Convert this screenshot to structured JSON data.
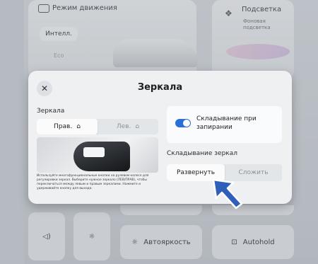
{
  "background": {
    "drive_mode": {
      "label": "Режим движения",
      "mode_button": "Интелл.",
      "mode_sub": "Eco"
    },
    "lighting": {
      "label": "Подсветка",
      "sub1": "Фоновая",
      "sub2": "подсветка"
    },
    "bottom": {
      "auto_brightness": "Автояркость",
      "autohold": "Autohold"
    }
  },
  "dialog": {
    "title": "Зеркала",
    "close_icon": "close-icon",
    "mirrors_label": "Зеркала",
    "mirror_select": {
      "right": "Прав.",
      "left": "Лев.",
      "selected": "Прав."
    },
    "fold_on_lock": {
      "label": "Складывание при запирании",
      "enabled": true
    },
    "folding_label": "Складывание зеркал",
    "folding_buttons": {
      "unfold": "Развернуть",
      "fold": "Сложить",
      "selected": "Развернуть"
    },
    "note": "Используйте многофункциональные кнопки на рулевом колесе для регулировки зеркал. Выберите нужное зеркало (ЛЕВ/ПРАВ), чтобы переключаться между левым и правым зеркалами. Нажмите и удерживайте кнопку для выхода."
  },
  "colors": {
    "accent": "#2b6fd6",
    "arrow": "#2f5fb8"
  }
}
